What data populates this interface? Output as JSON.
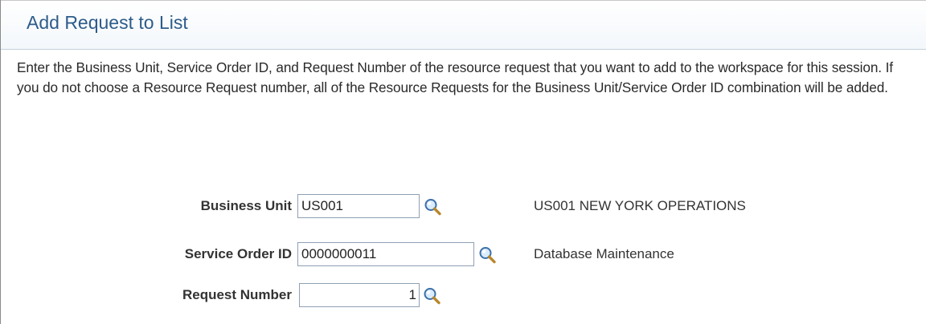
{
  "header": {
    "title": "Add Request to List"
  },
  "instructions": "Enter the Business Unit, Service Order ID, and Request Number of the resource request that you want to add to the workspace for this session. If you do not choose a Resource Request number, all of the Resource Requests for the Business Unit/Service Order ID combination will be added.",
  "form": {
    "business_unit": {
      "label": "Business Unit",
      "value": "US001",
      "description": "US001 NEW YORK OPERATIONS",
      "lookup_icon": "magnifier-icon"
    },
    "service_order_id": {
      "label": "Service Order ID",
      "value": "0000000011",
      "description": "Database Maintenance",
      "lookup_icon": "magnifier-icon"
    },
    "request_number": {
      "label": "Request Number",
      "value": "1",
      "lookup_icon": "magnifier-icon"
    }
  },
  "colors": {
    "title": "#2d5c8a",
    "input_border": "#8fa0b4"
  }
}
